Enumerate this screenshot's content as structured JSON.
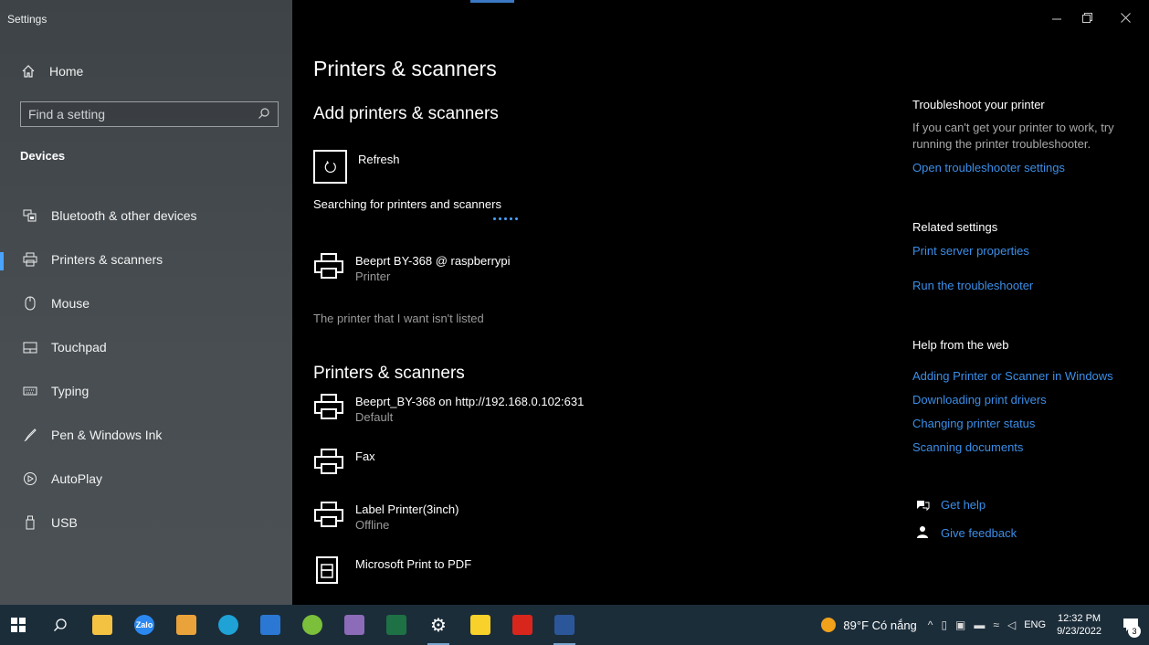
{
  "app": {
    "title": "Settings"
  },
  "sidebar": {
    "home_label": "Home",
    "search_placeholder": "Find a setting",
    "section_title": "Devices",
    "items": [
      {
        "label": "Bluetooth & other devices",
        "icon": "bluetooth-devices-icon"
      },
      {
        "label": "Printers & scanners",
        "icon": "printer-icon",
        "active": true
      },
      {
        "label": "Mouse",
        "icon": "mouse-icon"
      },
      {
        "label": "Touchpad",
        "icon": "touchpad-icon"
      },
      {
        "label": "Typing",
        "icon": "keyboard-icon"
      },
      {
        "label": "Pen & Windows Ink",
        "icon": "pen-icon"
      },
      {
        "label": "AutoPlay",
        "icon": "autoplay-icon"
      },
      {
        "label": "USB",
        "icon": "usb-icon"
      }
    ]
  },
  "main": {
    "page_title": "Printers & scanners",
    "add_title": "Add printers & scanners",
    "refresh_label": "Refresh",
    "searching_text": "Searching for printers and scanners",
    "found_printer": {
      "name": "Beeprt BY-368 @ raspberrypi",
      "status": "Printer"
    },
    "not_listed": "The printer that I want isn't listed",
    "list_title": "Printers & scanners",
    "printers": [
      {
        "name": "Beeprt_BY-368 on http://192.168.0.102:631",
        "status": "Default"
      },
      {
        "name": "Fax",
        "status": ""
      },
      {
        "name": "Label Printer(3inch)",
        "status": "Offline"
      },
      {
        "name": "Microsoft Print to PDF",
        "status": ""
      }
    ]
  },
  "right": {
    "troubleshoot_title": "Troubleshoot your printer",
    "troubleshoot_text": "If you can't get your printer to work, try running the printer troubleshooter.",
    "troubleshoot_link": "Open troubleshooter settings",
    "related_title": "Related settings",
    "related_links": [
      "Print server properties",
      "Run the troubleshooter"
    ],
    "web_title": "Help from the web",
    "web_links": [
      "Adding Printer or Scanner in Windows",
      "Downloading print drivers",
      "Changing printer status",
      "Scanning documents"
    ],
    "get_help": "Get help",
    "give_feedback": "Give feedback"
  },
  "taskbar": {
    "weather": "89°F  Có nắng",
    "lang": "ENG",
    "time": "12:32 PM",
    "date": "9/23/2022",
    "notif_count": "3",
    "zalo_label": "Zalo",
    "colors": {
      "bg": "#1c2d3a",
      "accent": "#3b8ee8"
    }
  }
}
